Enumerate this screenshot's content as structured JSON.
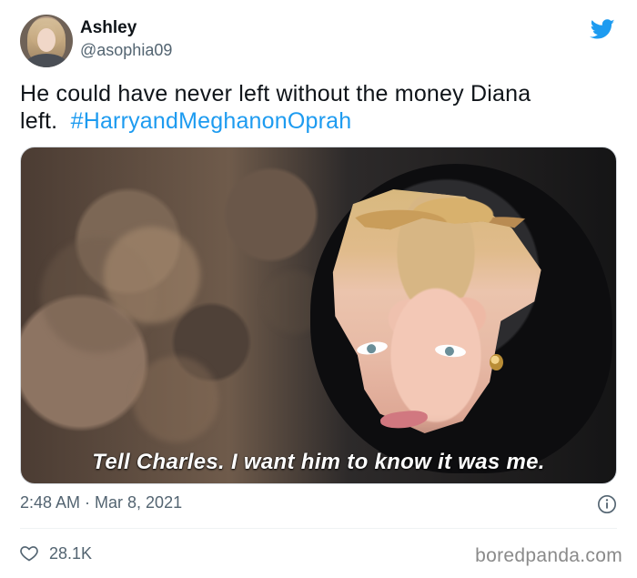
{
  "author": {
    "name": "Ashley",
    "handle": "@asophia09"
  },
  "tweet": {
    "text_main": "He could have never left without the money Diana\nleft.",
    "hashtag": "#HarryandMeghanonOprah",
    "timestamp": "2:48 AM · Mar 8, 2021",
    "likes": "28.1K"
  },
  "media": {
    "caption": "Tell Charles. I want him to know it was me."
  },
  "icons": {
    "platform": "twitter-bird-icon",
    "info": "info-icon",
    "like": "heart-icon"
  },
  "colors": {
    "twitter_blue": "#1d9bf0",
    "secondary_text": "#536471"
  },
  "watermark": "boredpanda.com"
}
